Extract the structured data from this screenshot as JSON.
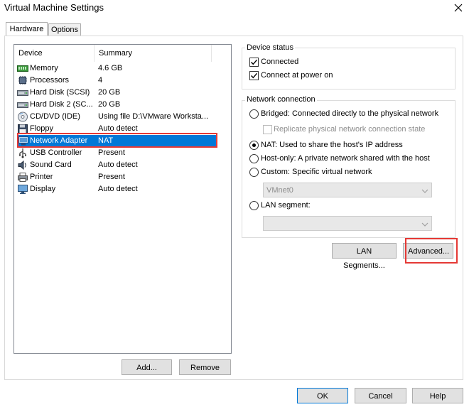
{
  "window": {
    "title": "Virtual Machine Settings"
  },
  "tabs": [
    {
      "label": "Hardware",
      "active": true
    },
    {
      "label": "Options",
      "active": false
    }
  ],
  "device_list": {
    "columns": [
      "Device",
      "Summary"
    ],
    "rows": [
      {
        "icon": "memory-icon",
        "device": "Memory",
        "summary": "4.6 GB"
      },
      {
        "icon": "processor-icon",
        "device": "Processors",
        "summary": "4"
      },
      {
        "icon": "hard-disk-icon",
        "device": "Hard Disk (SCSI)",
        "summary": "20 GB"
      },
      {
        "icon": "hard-disk-icon",
        "device": "Hard Disk 2 (SC...",
        "summary": "20 GB"
      },
      {
        "icon": "cd-dvd-icon",
        "device": "CD/DVD (IDE)",
        "summary": "Using file D:\\VMware Worksta..."
      },
      {
        "icon": "floppy-icon",
        "device": "Floppy",
        "summary": "Auto detect"
      },
      {
        "icon": "network-adapter-icon",
        "device": "Network Adapter",
        "summary": "NAT",
        "selected": true
      },
      {
        "icon": "usb-icon",
        "device": "USB Controller",
        "summary": "Present"
      },
      {
        "icon": "sound-card-icon",
        "device": "Sound Card",
        "summary": "Auto detect"
      },
      {
        "icon": "printer-icon",
        "device": "Printer",
        "summary": "Present"
      },
      {
        "icon": "display-icon",
        "device": "Display",
        "summary": "Auto detect"
      }
    ]
  },
  "list_buttons": {
    "add": "Add...",
    "remove": "Remove"
  },
  "device_status": {
    "title": "Device status",
    "connected": {
      "label": "Connected",
      "checked": true
    },
    "connect_at_power_on": {
      "label": "Connect at power on",
      "checked": true
    }
  },
  "network_connection": {
    "title": "Network connection",
    "bridged": {
      "label": "Bridged: Connected directly to the physical network",
      "selected": false
    },
    "replicate": {
      "label": "Replicate physical network connection state",
      "checked": false,
      "disabled": true
    },
    "nat": {
      "label": "NAT: Used to share the host's IP address",
      "selected": true
    },
    "host_only": {
      "label": "Host-only: A private network shared with the host",
      "selected": false
    },
    "custom": {
      "label": "Custom: Specific virtual network",
      "selected": false
    },
    "custom_network": {
      "value": "VMnet0"
    },
    "lan_segment": {
      "label": "LAN segment:",
      "selected": false
    },
    "lan_segment_select": {
      "value": ""
    }
  },
  "network_buttons": {
    "lan_segments": "LAN Segments...",
    "advanced": "Advanced..."
  },
  "footer": {
    "ok": "OK",
    "cancel": "Cancel",
    "help": "Help"
  },
  "colors": {
    "selection": "#0078d7",
    "highlight_box": "#e53935"
  }
}
